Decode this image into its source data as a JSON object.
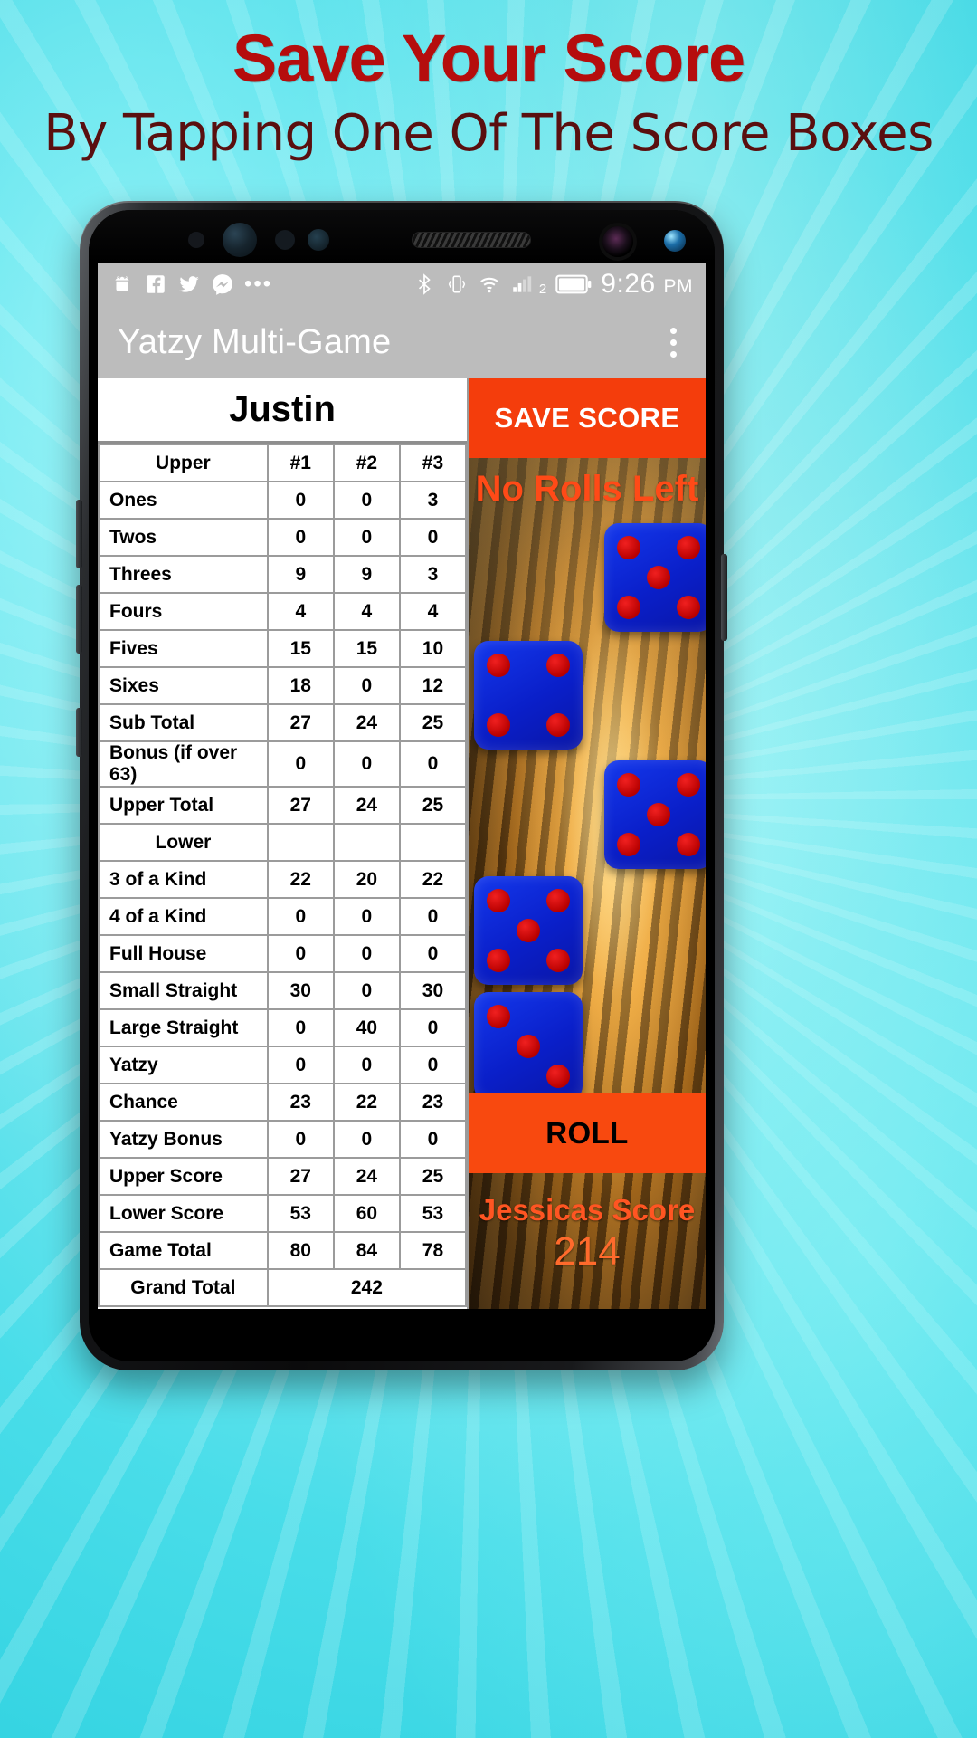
{
  "promo": {
    "headline": "Save Your Score",
    "subline": "By Tapping One Of The Score Boxes",
    "headline_color": "#b50d0d",
    "subline_color": "#5a0f0f",
    "background_color": "#49dde9"
  },
  "statusbar": {
    "time": "9:26",
    "ampm": "PM",
    "left_icons": [
      "android-icon",
      "facebook-icon",
      "twitter-icon",
      "messenger-icon",
      "more-notifications-icon"
    ],
    "right_icons": [
      "bluetooth-icon",
      "vibrate-icon",
      "wifi-icon",
      "signal-icon",
      "battery-icon"
    ],
    "signal_sim": "2"
  },
  "appbar": {
    "title": "Yatzy Multi-Game",
    "overflow_icon": "kebab-menu-icon"
  },
  "scorecard": {
    "player": "Justin",
    "columns": [
      "#1",
      "#2",
      "#3"
    ],
    "section_upper": "Upper",
    "section_lower": "Lower",
    "rows": [
      {
        "label": "Ones",
        "values": [
          "0",
          "0",
          "3"
        ],
        "red": [
          true,
          true,
          false
        ]
      },
      {
        "label": "Twos",
        "values": [
          "0",
          "0",
          "0"
        ],
        "red": [
          true,
          true,
          true
        ]
      },
      {
        "label": "Threes",
        "values": [
          "9",
          "9",
          "3"
        ],
        "red": [
          false,
          false,
          true
        ]
      },
      {
        "label": "Fours",
        "values": [
          "4",
          "4",
          "4"
        ],
        "red": [
          true,
          true,
          true
        ]
      },
      {
        "label": "Fives",
        "values": [
          "15",
          "15",
          "10"
        ],
        "red": [
          true,
          false,
          false
        ]
      },
      {
        "label": "Sixes",
        "values": [
          "18",
          "0",
          "12"
        ],
        "red": [
          false,
          true,
          false
        ]
      },
      {
        "label": "Sub Total",
        "values": [
          "27",
          "24",
          "25"
        ],
        "red": [
          false,
          false,
          false
        ]
      },
      {
        "label": "Bonus (if over 63)",
        "values": [
          "0",
          "0",
          "0"
        ],
        "red": [
          false,
          false,
          false
        ]
      },
      {
        "label": "Upper Total",
        "values": [
          "27",
          "24",
          "25"
        ],
        "red": [
          false,
          false,
          false
        ]
      }
    ],
    "lower_rows": [
      {
        "label": "3 of a Kind",
        "values": [
          "22",
          "20",
          "22"
        ],
        "red": [
          true,
          false,
          true
        ]
      },
      {
        "label": "4 of a Kind",
        "values": [
          "0",
          "0",
          "0"
        ],
        "red": [
          true,
          true,
          true
        ]
      },
      {
        "label": "Full House",
        "values": [
          "0",
          "0",
          "0"
        ],
        "red": [
          true,
          true,
          true
        ]
      },
      {
        "label": "Small Straight",
        "values": [
          "30",
          "0",
          "30"
        ],
        "red": [
          false,
          true,
          false
        ]
      },
      {
        "label": "Large Straight",
        "values": [
          "0",
          "40",
          "0"
        ],
        "red": [
          true,
          false,
          true
        ]
      },
      {
        "label": "Yatzy",
        "values": [
          "0",
          "0",
          "0"
        ],
        "red": [
          true,
          true,
          true
        ]
      },
      {
        "label": "Chance",
        "values": [
          "23",
          "22",
          "23"
        ],
        "red": [
          false,
          true,
          false
        ]
      },
      {
        "label": "Yatzy Bonus",
        "values": [
          "0",
          "0",
          "0"
        ],
        "red": [
          false,
          false,
          false
        ]
      },
      {
        "label": "Upper Score",
        "values": [
          "27",
          "24",
          "25"
        ],
        "red": [
          false,
          false,
          false
        ]
      },
      {
        "label": "Lower Score",
        "values": [
          "53",
          "60",
          "53"
        ],
        "red": [
          false,
          false,
          false
        ]
      },
      {
        "label": "Game Total",
        "values": [
          "80",
          "84",
          "78"
        ],
        "red": [
          false,
          false,
          false
        ]
      }
    ],
    "grand_total_label": "Grand Total",
    "grand_total_value": "242",
    "score_red_color": "#ef0000"
  },
  "gamepanel": {
    "save_button": "SAVE SCORE",
    "rolls_status": "No Rolls Left",
    "roll_button": "ROLL",
    "opponent_name": "Jessicas Score",
    "opponent_score": "214",
    "accent_color": "#f43d0c",
    "dice": [
      {
        "face": 5
      },
      {
        "face": 4
      },
      {
        "face": 5
      },
      {
        "face": 5
      },
      {
        "face": 3
      }
    ]
  }
}
